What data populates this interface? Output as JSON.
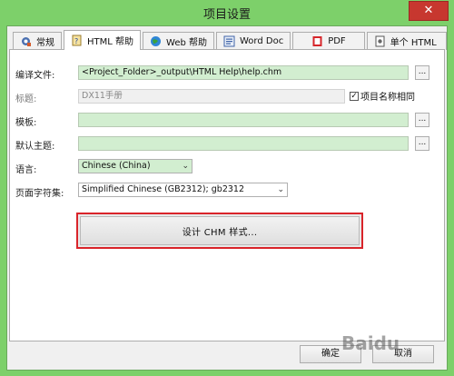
{
  "window": {
    "title": "项目设置",
    "close_glyph": "✕"
  },
  "tabs": [
    {
      "label": "常规",
      "icon": "gear-icon",
      "active": false
    },
    {
      "label": "HTML 帮助",
      "icon": "html-help-icon",
      "active": true
    },
    {
      "label": "Web 帮助",
      "icon": "globe-icon",
      "active": false
    },
    {
      "label": "Word Doc",
      "icon": "word-doc-icon",
      "active": false
    },
    {
      "label": "PDF",
      "icon": "pdf-icon",
      "active": false
    },
    {
      "label": "单个 HTML",
      "icon": "single-html-icon",
      "active": false
    }
  ],
  "form": {
    "compile_file": {
      "label": "编译文件:",
      "value": "<Project_Folder>_output\\HTML Help\\help.chm",
      "browse": "..."
    },
    "title": {
      "label": "标题:",
      "value": "DX11手册"
    },
    "same_as_project": {
      "label": "项目名称相同",
      "checked": true,
      "check_glyph": "✓"
    },
    "template": {
      "label": "模板:",
      "value": "",
      "browse": "..."
    },
    "default_topic": {
      "label": "默认主题:",
      "value": "",
      "browse": "..."
    },
    "language": {
      "label": "语言:",
      "value": "Chinese (China)",
      "arrow": "⌄"
    },
    "charset": {
      "label": "页面字符集:",
      "value": "Simplified Chinese (GB2312); gb2312",
      "arrow": "⌄"
    }
  },
  "design_button": {
    "label": "设计 CHM 样式..."
  },
  "footer": {
    "ok_label": "确定",
    "cancel_label": "取消"
  },
  "watermark": {
    "text": "Baidu"
  },
  "colors": {
    "accent_frame": "#7dd06a",
    "field_bg": "#d2eed0",
    "highlight_border": "#d9242a",
    "close_red": "#c7372f"
  }
}
